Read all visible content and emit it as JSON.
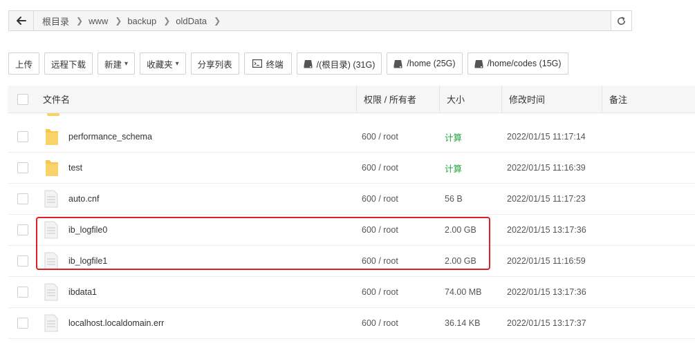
{
  "breadcrumb": {
    "items": [
      "根目录",
      "www",
      "backup",
      "oldData"
    ]
  },
  "toolbar": {
    "upload": "上传",
    "remote_download": "远程下载",
    "new": "新建",
    "favorites": "收藏夹",
    "share_list": "分享列表",
    "terminal": "终端",
    "disks": [
      "/(根目录) (31G)",
      "/home (25G)",
      "/home/codes (15G)"
    ]
  },
  "table": {
    "headers": {
      "name": "文件名",
      "perm": "权限 / 所有者",
      "size": "大小",
      "mtime": "修改时间",
      "note": "备注"
    },
    "rows": [
      {
        "type": "folder",
        "name": "performance_schema",
        "perm": "600 / root",
        "size": "计算",
        "mtime": "2022/01/15 11:17:14"
      },
      {
        "type": "folder",
        "name": "test",
        "perm": "600 / root",
        "size": "计算",
        "mtime": "2022/01/15 11:16:39"
      },
      {
        "type": "file",
        "name": "auto.cnf",
        "perm": "600 / root",
        "size": "56 B",
        "mtime": "2022/01/15 11:17:23"
      },
      {
        "type": "file",
        "name": "ib_logfile0",
        "perm": "600 / root",
        "size": "2.00 GB",
        "mtime": "2022/01/15 13:17:36"
      },
      {
        "type": "file",
        "name": "ib_logfile1",
        "perm": "600 / root",
        "size": "2.00 GB",
        "mtime": "2022/01/15 11:16:59"
      },
      {
        "type": "file",
        "name": "ibdata1",
        "perm": "600 / root",
        "size": "74.00 MB",
        "mtime": "2022/01/15 13:17:36"
      },
      {
        "type": "file",
        "name": "localhost.localdomain.err",
        "perm": "600 / root",
        "size": "36.14 KB",
        "mtime": "2022/01/15 13:17:37"
      }
    ]
  },
  "colors": {
    "calc_green": "#20a53a",
    "highlight_red": "#e02020",
    "folder_yellow": "#f6c94a"
  }
}
